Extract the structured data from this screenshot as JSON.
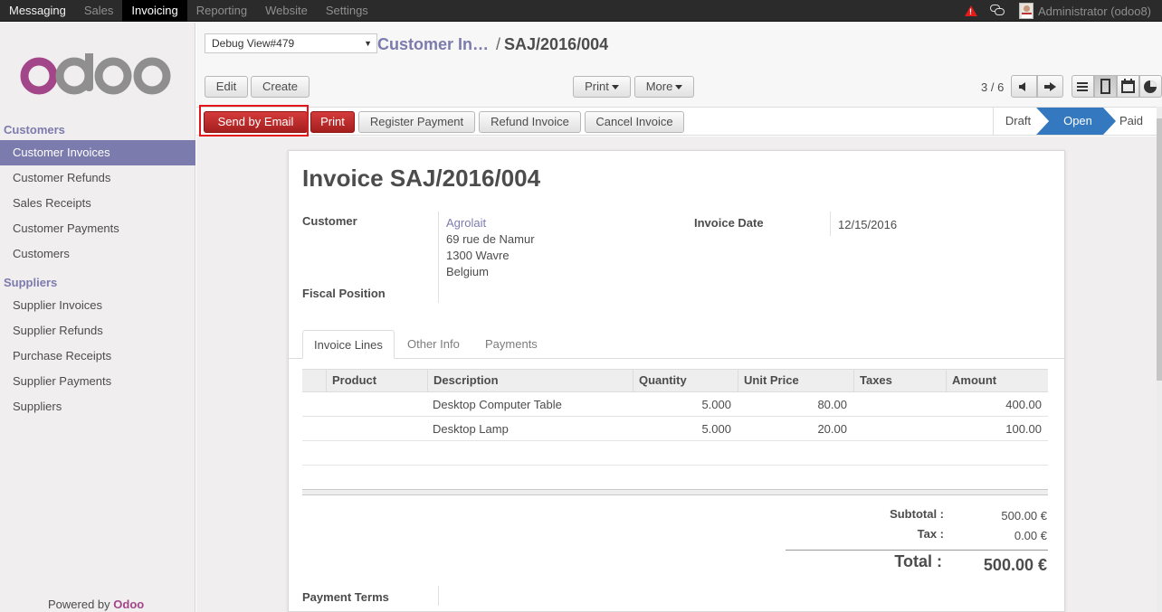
{
  "topmenu": {
    "items": [
      "Messaging",
      "Sales",
      "Invoicing",
      "Reporting",
      "Website",
      "Settings"
    ],
    "active": "Invoicing",
    "user": "Administrator (odoo8)"
  },
  "sidebar": {
    "logo": "odoo",
    "sections": [
      {
        "title": "Customers",
        "items": [
          "Customer Invoices",
          "Customer Refunds",
          "Sales Receipts",
          "Customer Payments",
          "Customers"
        ]
      },
      {
        "title": "Suppliers",
        "items": [
          "Supplier Invoices",
          "Supplier Refunds",
          "Purchase Receipts",
          "Supplier Payments",
          "Suppliers"
        ]
      }
    ],
    "active_item": "Customer Invoices",
    "powered_prefix": "Powered by",
    "powered_brand": "Odoo"
  },
  "control_panel": {
    "debug_select": "Debug View#479",
    "breadcrumb_parent": "Customer In…",
    "breadcrumb_sep": "/",
    "breadcrumb_current": "SAJ/2016/004",
    "edit_label": "Edit",
    "create_label": "Create",
    "print_menu_label": "Print",
    "more_menu_label": "More",
    "pager": "3 / 6"
  },
  "statusbar": {
    "buttons": [
      "Send by Email",
      "Print",
      "Register Payment",
      "Refund Invoice",
      "Cancel Invoice"
    ],
    "stages": [
      "Draft",
      "Open",
      "Paid"
    ],
    "current_stage": "Open",
    "colors": {
      "primary_red": "#b62a2a",
      "stage_active": "#3478bf",
      "accent": "#7c7bad"
    }
  },
  "invoice": {
    "title_prefix": "Invoice",
    "number": "SAJ/2016/004",
    "customer_label": "Customer",
    "customer_name": "Agrolait",
    "address_lines": [
      "69 rue de Namur",
      "1300 Wavre",
      "Belgium"
    ],
    "fiscal_position_label": "Fiscal Position",
    "invoice_date_label": "Invoice Date",
    "invoice_date": "12/15/2016",
    "tabs": [
      "Invoice Lines",
      "Other Info",
      "Payments"
    ],
    "active_tab": "Invoice Lines",
    "columns": [
      "Product",
      "Description",
      "Quantity",
      "Unit Price",
      "Taxes",
      "Amount"
    ],
    "lines": [
      {
        "product": "",
        "description": "Desktop Computer Table",
        "quantity": "5.000",
        "unit_price": "80.00",
        "taxes": "",
        "amount": "400.00"
      },
      {
        "product": "",
        "description": "Desktop Lamp",
        "quantity": "5.000",
        "unit_price": "20.00",
        "taxes": "",
        "amount": "100.00"
      }
    ],
    "subtotal_label": "Subtotal :",
    "subtotal": "500.00 €",
    "tax_label": "Tax :",
    "tax": "0.00 €",
    "total_label": "Total :",
    "total": "500.00 €",
    "payment_terms_label": "Payment Terms"
  }
}
